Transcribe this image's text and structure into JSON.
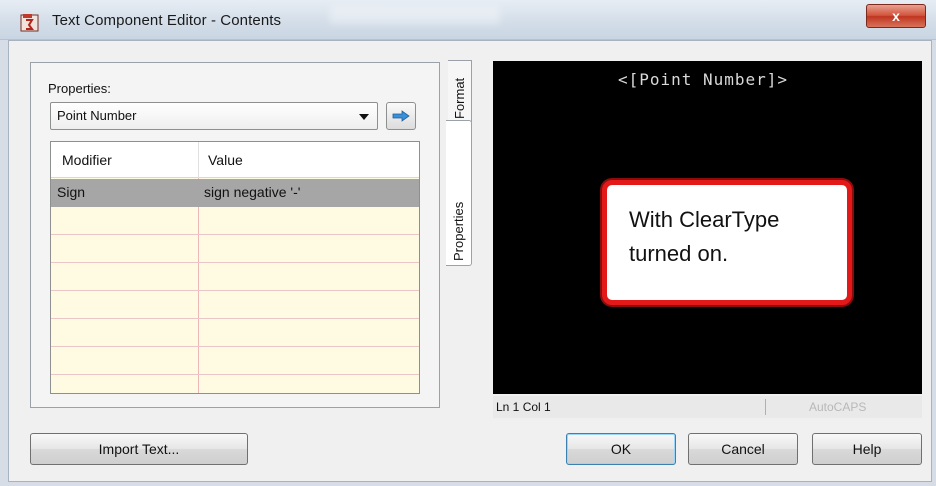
{
  "window": {
    "title": "Text Component Editor - Contents",
    "close_label": "x"
  },
  "properties": {
    "label": "Properties:",
    "selected": "Point Number",
    "go_icon": "arrow-right-icon"
  },
  "table": {
    "columns": [
      "Modifier",
      "Value"
    ],
    "rows": [
      {
        "modifier": "Sign",
        "value": "sign negative '-'",
        "selected": true
      }
    ]
  },
  "tabs": {
    "format": "Format",
    "properties": "Properties"
  },
  "preview": {
    "text": "<[Point Number]>",
    "callout": "With ClearType turned on.",
    "callout_color": "#e31818",
    "background": "#000000"
  },
  "status": {
    "position": "Ln 1 Col 1",
    "brand": "AutoCAPS"
  },
  "buttons": {
    "import": "Import Text...",
    "ok": "OK",
    "cancel": "Cancel",
    "help": "Help"
  }
}
